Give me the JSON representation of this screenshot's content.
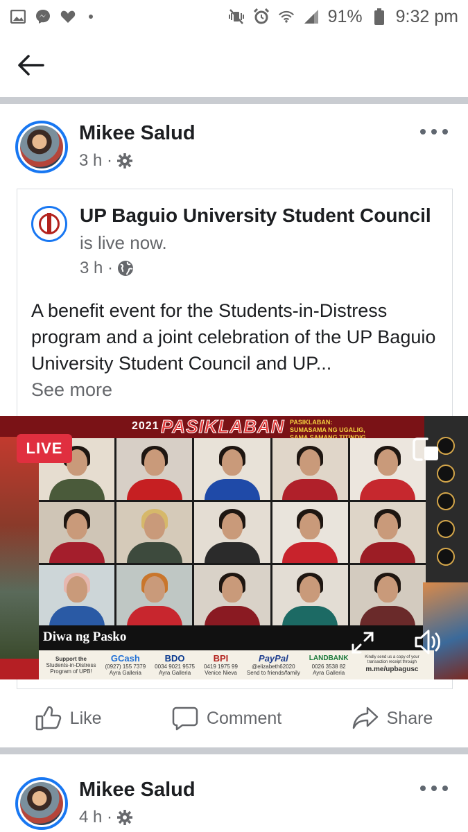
{
  "status_bar": {
    "battery": "91%",
    "time": "9:32 pm",
    "left_icons": [
      "image-icon",
      "messenger-icon",
      "heart-icon"
    ],
    "right_icons": [
      "vibrate-mute-icon",
      "alarm-icon",
      "wifi-icon",
      "signal-icon",
      "battery-icon"
    ]
  },
  "app_bar": {
    "back_icon": "back-arrow-icon"
  },
  "post1": {
    "author": "Mikee Salud",
    "time": "3 h ·",
    "privacy_icon": "gear-icon",
    "shared": {
      "page_name": "UP Baguio University Student Council",
      "status": "is live now.",
      "time": "3 h ·",
      "privacy_icon": "globe-icon",
      "text": "A benefit event for the Students-in-Distress program and a joint celebration of the UP Baguio University Student Council and UP...",
      "see_more": "See more"
    },
    "video": {
      "live_label": "LIVE",
      "event_year": "2021",
      "event_title": "PASIKLABAN",
      "event_tagline": "PASIKLABAN: SUMASAMA NG UGALIG, SAMA SAMANG TITINDIG",
      "caption": "Diwa ng Pasko",
      "sponsors": [
        {
          "brand": "Support the",
          "line1": "Students-in-Distress",
          "line2": "Program of UPB!"
        },
        {
          "brand": "GCash",
          "line1": "(0927) 155 7379",
          "line2": "Ayra Galleria"
        },
        {
          "brand": "BDO",
          "line1": "0034 9021 9575",
          "line2": "Ayra Galleria"
        },
        {
          "brand": "BPI",
          "line1": "0419 1975 99",
          "line2": "Venice Nieva"
        },
        {
          "brand": "PayPal",
          "line1": "@elizabeth62020",
          "line2": "Send to friends/family"
        },
        {
          "brand": "LANDBANK",
          "line1": "0026 3538 82",
          "line2": "Ayra Galleria"
        },
        {
          "brand": "Kindly send us a copy of your transaction receipt through",
          "line1": "m.me/upbagusc",
          "line2": ""
        }
      ]
    },
    "actions": {
      "like": "Like",
      "comment": "Comment",
      "share": "Share"
    }
  },
  "post2": {
    "author": "Mikee Salud",
    "time": "4 h ·",
    "privacy_icon": "gear-icon"
  }
}
